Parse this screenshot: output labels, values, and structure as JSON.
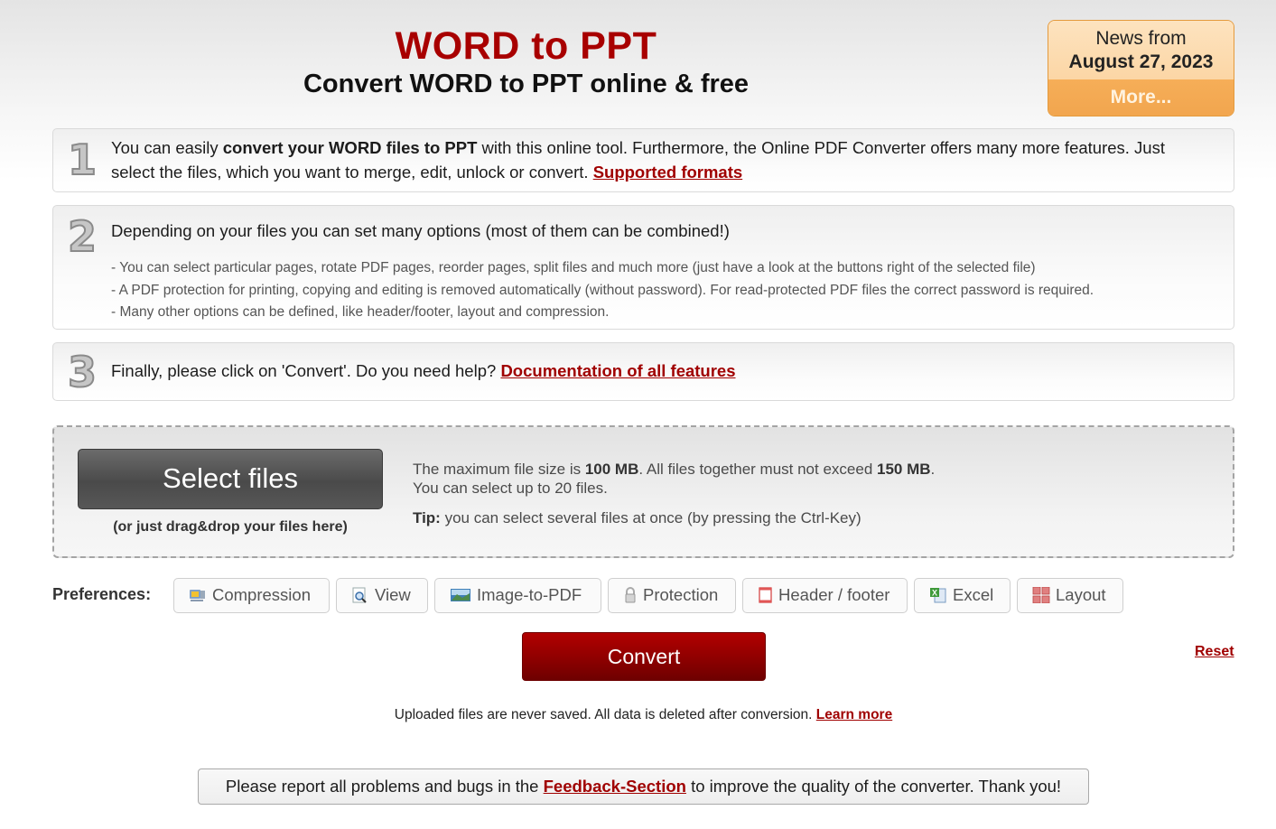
{
  "header": {
    "title": "WORD to PPT",
    "subtitle": "Convert WORD to PPT online & free"
  },
  "news": {
    "from_label": "News from",
    "date": "August 27, 2023",
    "more_label": "More..."
  },
  "steps": [
    {
      "number": "1",
      "text_before": "You can easily ",
      "text_bold": "convert your WORD files to PPT",
      "text_after": " with this online tool. Furthermore, the Online PDF Converter offers many more features. Just select the files, which you want to merge, edit, unlock or convert. ",
      "link": "Supported formats"
    },
    {
      "number": "2",
      "text": "Depending on your files you can set many options (most of them can be combined!)",
      "bullets": [
        "- You can select particular pages, rotate PDF pages, reorder pages, split files and much more (just have a look at the buttons right of the selected file)",
        "- A PDF protection for printing, copying and editing is removed automatically (without password). For read-protected PDF files the correct password is required.",
        "- Many other options can be defined, like header/footer, layout and compression."
      ]
    },
    {
      "number": "3",
      "text": "Finally, please click on 'Convert'. Do you need help? ",
      "link": "Documentation of all features"
    }
  ],
  "upload": {
    "select_label": "Select files",
    "drag_hint": "(or just drag&drop your files here)",
    "max_size_prefix": "The maximum file size is ",
    "max_size": "100 MB",
    "total_prefix": ". All files together must not exceed ",
    "total_size": "150 MB",
    "total_suffix": ".",
    "max_files": "You can select up to 20 files.",
    "tip_label": "Tip:",
    "tip_text": " you can select several files at once (by pressing the Ctrl-Key)"
  },
  "preferences": {
    "label": "Preferences:",
    "buttons": [
      {
        "label": "Compression",
        "icon": "compression-icon"
      },
      {
        "label": "View",
        "icon": "view-magnifier-icon"
      },
      {
        "label": "Image-to-PDF",
        "icon": "image-icon"
      },
      {
        "label": "Protection",
        "icon": "lock-icon"
      },
      {
        "label": "Header / footer",
        "icon": "header-footer-icon"
      },
      {
        "label": "Excel",
        "icon": "excel-icon"
      },
      {
        "label": "Layout",
        "icon": "layout-grid-icon"
      }
    ]
  },
  "actions": {
    "convert_label": "Convert",
    "reset_label": "Reset"
  },
  "privacy": {
    "text": "Uploaded files are never saved. All data is deleted after conversion. ",
    "link": "Learn more"
  },
  "feedback": {
    "before": "Please report all problems and bugs in the ",
    "link": "Feedback-Section",
    "after": " to improve the quality of the converter. Thank you!"
  },
  "colors": {
    "brand_red": "#a80000",
    "news_orange": "#f1a54e",
    "select_button": "#555555"
  }
}
